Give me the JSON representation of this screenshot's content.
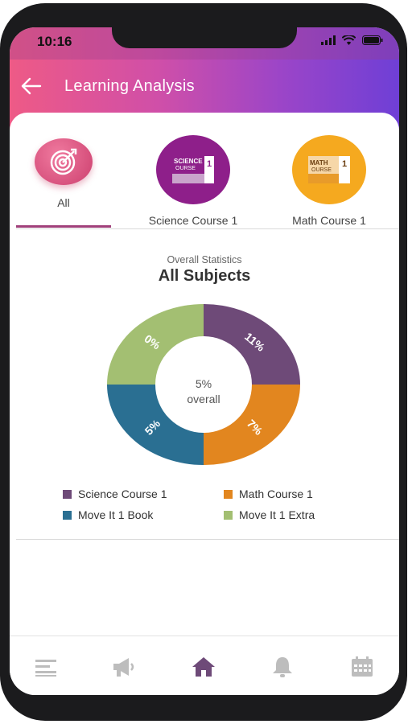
{
  "status": {
    "time": "10:16"
  },
  "header": {
    "title": "Learning Analysis",
    "back_icon": "arrow-left-icon"
  },
  "tabs": [
    {
      "label": "All",
      "icon": "target-icon",
      "active": true
    },
    {
      "label": "Science Course 1",
      "icon": "science-course-thumbnail",
      "thumb_text": "SCIENCE",
      "thumb_text2": "OURSE",
      "thumb_num": "1"
    },
    {
      "label": "Math Course 1",
      "icon": "math-course-thumbnail",
      "thumb_text": "MATH",
      "thumb_text2": "OURSE",
      "thumb_num": "1"
    }
  ],
  "stats": {
    "caption": "Overall Statistics",
    "title": "All Subjects",
    "overall_value": "5%",
    "overall_label": "overall"
  },
  "chart_data": {
    "type": "pie",
    "series": [
      {
        "name": "Science Course 1",
        "value": 11,
        "label": "11%",
        "color": "#6e4a78"
      },
      {
        "name": "Math Course 1",
        "value": 7,
        "label": "7%",
        "color": "#e2861f"
      },
      {
        "name": "Move It 1 Book",
        "value": 5,
        "label": "5%",
        "color": "#2a6f92"
      },
      {
        "name": "Move It 1 Extra",
        "value": 0,
        "label": "0%",
        "color": "#a3bf72"
      }
    ]
  },
  "legend": [
    {
      "label": "Science Course 1",
      "color": "#6e4a78"
    },
    {
      "label": "Math Course 1",
      "color": "#e2861f"
    },
    {
      "label": "Move It 1 Book",
      "color": "#2a6f92"
    },
    {
      "label": "Move It 1 Extra",
      "color": "#a3bf72"
    }
  ],
  "bottom_nav": [
    {
      "icon": "menu-icon",
      "active": false
    },
    {
      "icon": "megaphone-icon",
      "active": false
    },
    {
      "icon": "home-icon",
      "active": true
    },
    {
      "icon": "bell-icon",
      "active": false
    },
    {
      "icon": "calendar-icon",
      "active": false
    }
  ],
  "colors": {
    "accent": "#a0407a",
    "active_nav": "#6e4a78",
    "inactive_nav": "#bdbdbd"
  }
}
